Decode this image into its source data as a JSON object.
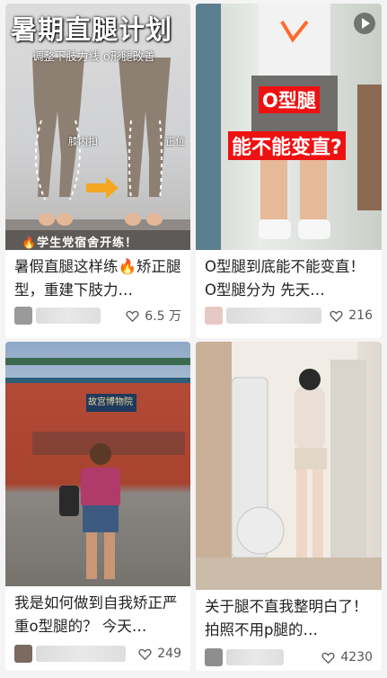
{
  "feed": {
    "items": [
      {
        "title": "暑假直腿这样练🔥矫正腿型，重建下肢力…",
        "likes": "6.5 万",
        "overlay": {
          "headline": "暑期直腿计划",
          "subhead": "调整下肢力线 o形腿改善",
          "label_left": "膝内扣",
          "label_right": "正位",
          "footer": "🔥学生党宿舍开练！"
        }
      },
      {
        "title": "O型腿到底能不能变直！ O型腿分为 先天…",
        "likes": "216",
        "overlay": {
          "line1": "O型腿",
          "line2": "能不能变直?"
        }
      },
      {
        "title": "我是如何做到自我矫正严重o型腿的？ 今天…",
        "likes": "249",
        "overlay": {
          "sign": "故宫博物院"
        }
      },
      {
        "title": "关于腿不直我整明白了！ 拍照不用p腿的…",
        "likes": "4230"
      }
    ]
  }
}
